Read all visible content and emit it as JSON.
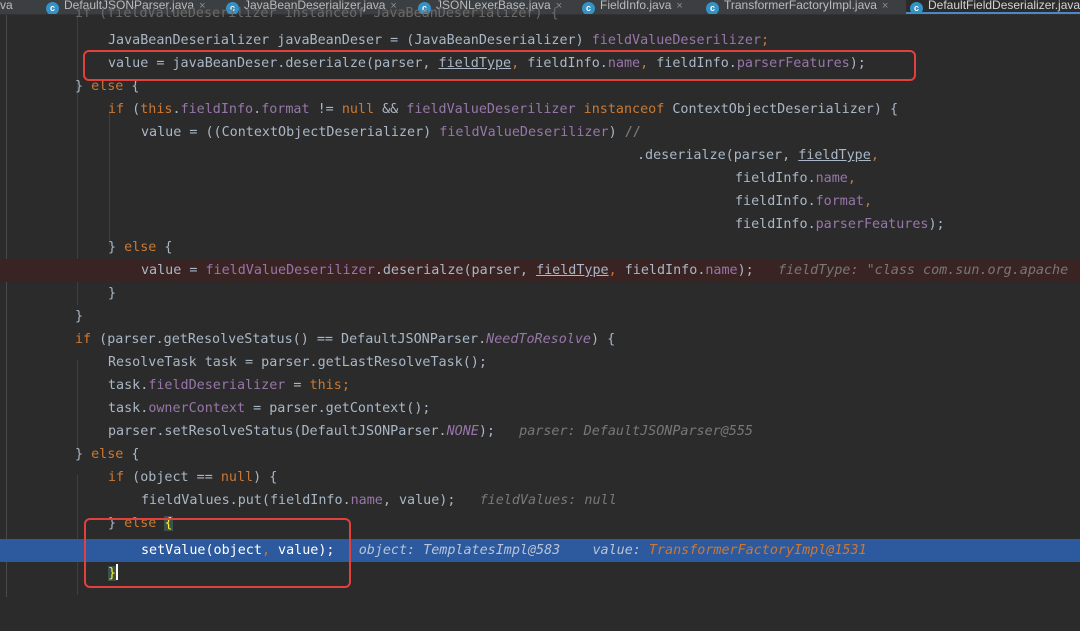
{
  "tabs": [
    {
      "name": "va",
      "close": "",
      "active": false
    },
    {
      "name": "DefaultJSONParser.java",
      "close": "×",
      "active": false
    },
    {
      "name": "JavaBeanDeserializer.java",
      "close": "×",
      "active": false
    },
    {
      "name": "JSONLexerBase.java",
      "close": "×",
      "active": false
    },
    {
      "name": "FieldInfo.java",
      "close": "×",
      "active": false
    },
    {
      "name": "TransformerFactoryImpl.java",
      "close": "×",
      "active": false
    },
    {
      "name": "DefaultFieldDeserializer.java",
      "close": "",
      "active": true
    }
  ],
  "tab_icon_letter": "c",
  "code": {
    "l0": {
      "a": "if (",
      "b": "fieldValueDeserilizer",
      "c": " instanceof ",
      "d": "JavaBeanDeserializer) {"
    },
    "l1": {
      "a": "JavaBeanDeserializer javaBeanDeser = (JavaBeanDeserializer) ",
      "b": "fieldValueDeserilizer",
      "c": ";"
    },
    "l2": {
      "a": "value = javaBeanDeser.deserialze(parser, ",
      "b": "fieldType",
      "c": ", ",
      "d": "fieldInfo",
      "e": ".",
      "f": "name",
      "g": ", ",
      "h": "fieldInfo",
      "i": ".",
      "j": "parserFeatures",
      "k": ");"
    },
    "l3": {
      "a": "} ",
      "b": "else",
      "c": " {"
    },
    "l4": {
      "a": "if",
      "b": " (",
      "c": "this",
      "d": ".",
      "e": "fieldInfo",
      "f": ".",
      "g": "format",
      "h": " != ",
      "i": "null",
      "j": " && ",
      "k": "fieldValueDeserilizer",
      "l": " instanceof ",
      "m": "ContextObjectDeserializer) {"
    },
    "l5": {
      "a": "value = ((ContextObjectDeserializer) ",
      "b": "fieldValueDeserilizer",
      "c": ") ",
      "d": "//"
    },
    "l6": {
      "a": ".deserialze(parser, ",
      "b": "fieldType",
      "c": ","
    },
    "l7": {
      "a": "fieldInfo",
      "b": ".",
      "c": "name",
      "d": ","
    },
    "l8": {
      "a": "fieldInfo",
      "b": ".",
      "c": "format",
      "d": ","
    },
    "l9": {
      "a": "fieldInfo",
      "b": ".",
      "c": "parserFeatures",
      "d": ");"
    },
    "l10": {
      "a": "} ",
      "b": "else",
      "c": " {"
    },
    "l11": {
      "a": "value = ",
      "b": "fieldValueDeserilizer",
      "c": ".deserialze(parser, ",
      "d": "fieldType",
      "e": ", ",
      "f": "fieldInfo",
      "g": ".",
      "h": "name",
      "i": ");",
      "hint": "fieldType: \"class com.sun.org.apache"
    },
    "l12": {
      "a": "}"
    },
    "l13": {
      "a": "}"
    },
    "l14": {
      "a": "if",
      "b": " (parser.getResolveStatus() == DefaultJSONParser.",
      "c": "NeedToResolve",
      "d": ") {"
    },
    "l15": {
      "a": "ResolveTask task = parser.getLastResolveTask();"
    },
    "l16": {
      "a": "task.",
      "b": "fieldDeserializer",
      "c": " = ",
      "d": "this",
      "e": ";"
    },
    "l17": {
      "a": "task.",
      "b": "ownerContext",
      "c": " = parser.getContext();"
    },
    "l18": {
      "a": "parser.setResolveStatus(DefaultJSONParser.",
      "b": "NONE",
      "c": ");",
      "hint": "parser: DefaultJSONParser@555"
    },
    "l19": {
      "a": "} ",
      "b": "else",
      "c": " {"
    },
    "l20": {
      "a": "if",
      "b": " (object == ",
      "c": "null",
      "d": ") {"
    },
    "l21": {
      "a": "fieldValues.put(",
      "b": "fieldInfo",
      "c": ".",
      "d": "name",
      "e": ", value);",
      "hint": "fieldValues: null"
    },
    "l22": {
      "a": "} ",
      "b": "else",
      "c": " ",
      "d": "{"
    },
    "l23": {
      "a": "setValue(object",
      "b": ",",
      "c": " value);",
      "hint1": "object: TemplatesImpl@583",
      "hint2": "value: ",
      "hint3": "TransformerFactoryImpl@1531"
    },
    "l24": {
      "a": "}"
    }
  },
  "colors": {
    "keyword": "#cc7832",
    "field": "#9876aa",
    "text": "#a9b7c6",
    "highlight_box": "#e0413d",
    "execution_line": "#2d5a9e",
    "breakpoint_line": "#3a2323"
  }
}
